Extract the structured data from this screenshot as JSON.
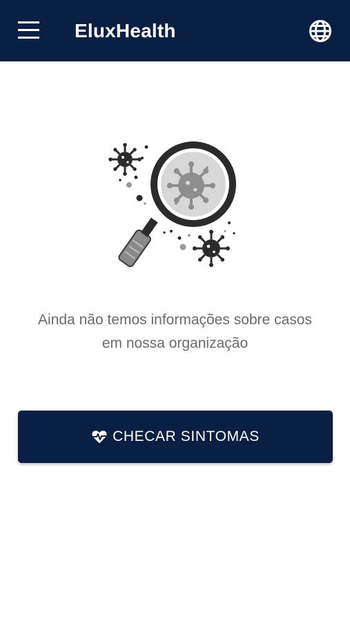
{
  "app_bar": {
    "title": "EluxHealth",
    "menu_icon": "menu-icon",
    "language_icon": "globe-icon",
    "background_color": "#0a1f44"
  },
  "empty_state": {
    "illustration": "virus-magnifier-illustration",
    "message": "Ainda não temos informações sobre casos em nossa organização"
  },
  "actions": {
    "check_symptoms_label": "CHECAR SINTOMAS",
    "check_symptoms_icon": "heart-pulse-icon",
    "button_color": "#0a1f44"
  }
}
